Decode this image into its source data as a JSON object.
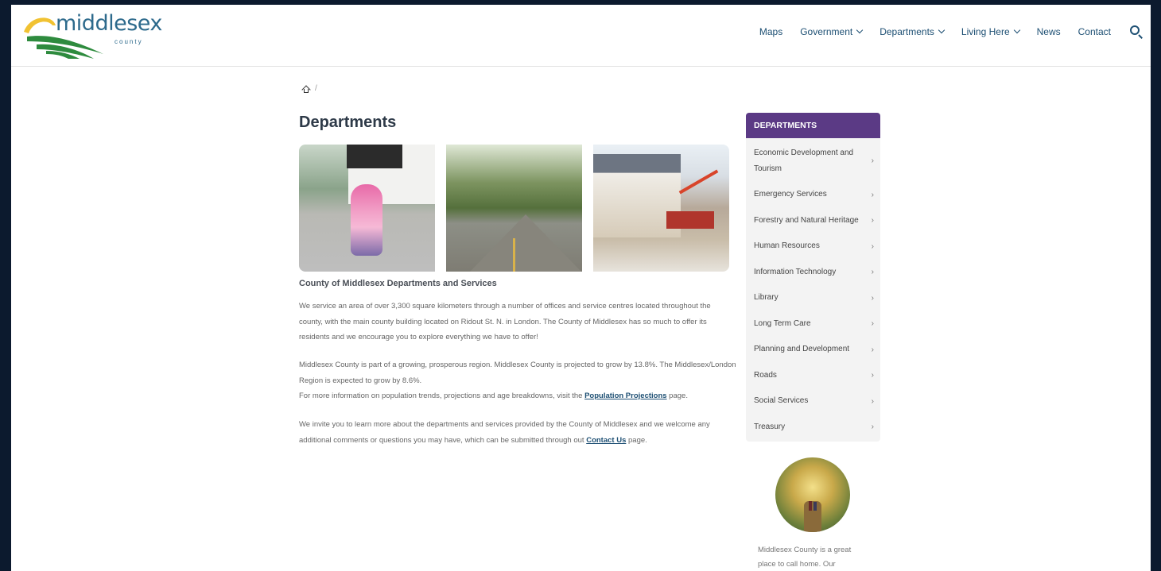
{
  "header": {
    "logo_text": "middlesex",
    "logo_sub": "county",
    "nav": [
      {
        "label": "Maps",
        "has_dropdown": false
      },
      {
        "label": "Government",
        "has_dropdown": true
      },
      {
        "label": "Departments",
        "has_dropdown": true
      },
      {
        "label": "Living Here",
        "has_dropdown": true
      },
      {
        "label": "News",
        "has_dropdown": false
      },
      {
        "label": "Contact",
        "has_dropdown": false
      }
    ],
    "search_icon": "search-icon"
  },
  "breadcrumb": {
    "home_icon": "home-icon",
    "separator": "/"
  },
  "main": {
    "title": "Departments",
    "intro_heading": "County of Middlesex Departments and Services",
    "para1": "We service an area of over 3,300 square kilometers through a number of offices and service centres located throughout the county, with the main county building located on Ridout St. N. in London. The County of Middlesex has so much to offer its residents and we encourage you to explore everything we have to offer!",
    "para2_line1": "Middlesex County is part of a growing, prosperous region.  Middlesex County is projected to grow by 13.8%.  The Middlesex/London Region is expected to grow by 8.6%.",
    "para2_line2_before": "For more information on population trends, projections and age breakdowns, visit the ",
    "para2_link": "Population Projections",
    "para2_line2_after": " page.",
    "para3_before": "We invite you to learn more about the departments and services provided by the County of Middlesex and we welcome any additional comments or questions you may have, which can be submitted through out ",
    "para3_link": "Contact Us",
    "para3_after": " page."
  },
  "sidebar": {
    "header": "DEPARTMENTS",
    "items": [
      {
        "label": "Economic Development and Tourism"
      },
      {
        "label": "Emergency Services"
      },
      {
        "label": "Forestry and Natural Heritage"
      },
      {
        "label": "Human Resources"
      },
      {
        "label": "Information Technology"
      },
      {
        "label": "Library"
      },
      {
        "label": "Long Term Care"
      },
      {
        "label": "Planning and Development"
      },
      {
        "label": "Roads"
      },
      {
        "label": "Social Services"
      },
      {
        "label": "Treasury"
      }
    ],
    "arrow": "›",
    "promo_text": "Middlesex County is a great place to call home. Our"
  },
  "colors": {
    "page_bg": "#0c1a2e",
    "nav_text": "#1d4f73",
    "sidebar_header": "#5b3a85",
    "sidebar_bg": "#f3f3f3",
    "title": "#2e3a48"
  }
}
